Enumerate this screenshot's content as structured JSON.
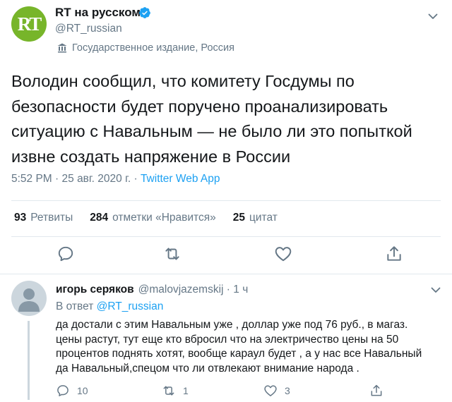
{
  "tweet": {
    "avatar_text": "RT",
    "display_name": "RT на русском",
    "handle": "@RT_russian",
    "state_label": "Государственное издание, Россия",
    "text": "Володин сообщил, что комитету Госдумы по безопасности будет поручено проанализировать ситуацию с Навальным — не было ли это попыткой извне создать напряжение в России",
    "time": "5:52 PM",
    "sep": " · ",
    "date": "25 авг. 2020 г.",
    "source": "Twitter Web App",
    "stats": {
      "retweets_count": "93",
      "retweets_label": "Ретвиты",
      "likes_count": "284",
      "likes_label": "отметки «Нравится»",
      "quotes_count": "25",
      "quotes_label": "цитат"
    }
  },
  "reply": {
    "display_name": "игорь серяков",
    "handle": "@malovjazemskij",
    "sep": " · ",
    "time": "1 ч",
    "reply_prefix": "В ответ ",
    "reply_mention": "@RT_russian",
    "text": "да достали с этим Навальным уже , доллар уже под  76 руб., в магаз.\nцены  растут, тут еще кто вбросил что на электричество цены на 50\nпроцентов поднять хотят, вообще караул будет , а у нас все Навальный\nда Навальный,спецом что ли  отвлекают внимание народа .",
    "reply_count": "10",
    "retweet_count": "1",
    "like_count": "3"
  },
  "colors": {
    "accent": "#1da1f2",
    "rt_green": "#77b52a",
    "secondary_text": "#657786",
    "divider": "#e1e8ed"
  },
  "icons": [
    "verified-badge-icon",
    "chevron-down-icon",
    "state-media-flag-icon",
    "reply-icon",
    "retweet-icon",
    "like-icon",
    "share-icon",
    "default-avatar-icon"
  ]
}
